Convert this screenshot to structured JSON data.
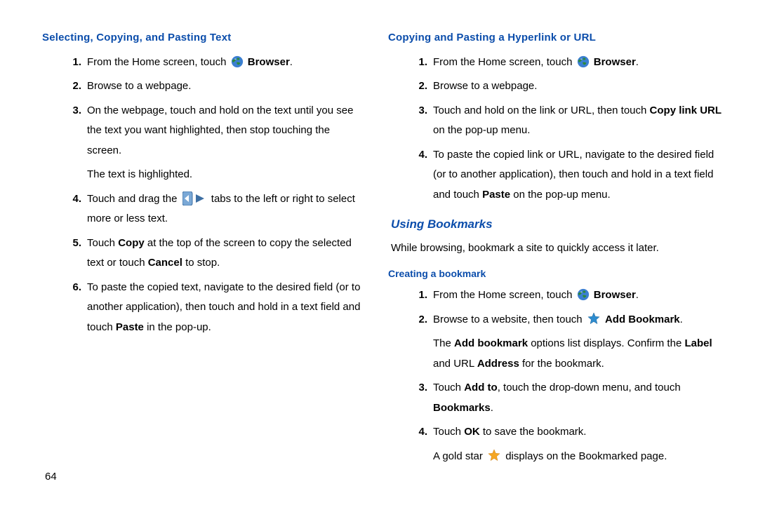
{
  "pagenum": "64",
  "left": {
    "h1": "Selecting, Copying, and Pasting Text",
    "s1a": "From the Home screen, touch ",
    "s1b_bold": "Browser",
    "s1c": ".",
    "s2": "Browse to a webpage.",
    "s3": "On the webpage, touch and hold on the text until you see the text you want highlighted, then stop touching the screen.",
    "s3_sub": "The text is highlighted.",
    "s4a": "Touch and drag the ",
    "s4b": " tabs to the left or right to select more or less text.",
    "s5a": "Touch ",
    "s5b_bold": "Copy",
    "s5c": " at the top of the screen to copy the selected text or touch ",
    "s5d_bold": "Cancel",
    "s5e": " to stop.",
    "s6a": "To paste the copied text, navigate to the desired field (or to another application), then touch and hold in a text field and touch ",
    "s6b_bold": "Paste",
    "s6c": " in the pop-up."
  },
  "rightA": {
    "h1": "Copying and Pasting a Hyperlink or URL",
    "s1a": "From the Home screen, touch ",
    "s1b_bold": "Browser",
    "s1c": ".",
    "s2": "Browse to a webpage.",
    "s3a": "Touch and hold on the link or URL, then touch ",
    "s3b_bold": "Copy link URL",
    "s3c": " on the pop-up menu.",
    "s4a": "To paste the copied link or URL, navigate to the desired field (or to another application), then touch and hold in a text field and touch ",
    "s4b_bold": "Paste",
    "s4c": " on the pop-up menu."
  },
  "rightB": {
    "h2": "Using Bookmarks",
    "intro": "While browsing, bookmark a site to quickly access it later.",
    "h3": "Creating a bookmark",
    "s1a": "From the Home screen, touch ",
    "s1b_bold": "Browser",
    "s1c": ".",
    "s2a": "Browse to a website, then touch ",
    "s2b_bold": "Add Bookmark",
    "s2c": ".",
    "s2_sub_a": "The ",
    "s2_sub_b_bold": "Add bookmark",
    "s2_sub_c": " options list displays. Confirm the ",
    "s2_sub_d_bold": "Label",
    "s2_sub_e": " and URL ",
    "s2_sub_f_bold": "Address",
    "s2_sub_g": " for the bookmark.",
    "s3a": "Touch ",
    "s3b_bold": "Add to",
    "s3c": ", touch the drop-down menu, and touch ",
    "s3d_bold": "Bookmarks",
    "s3e": ".",
    "s4a": "Touch ",
    "s4b_bold": "OK",
    "s4c": " to save the bookmark.",
    "s4_sub_a": "A gold star ",
    "s4_sub_b": " displays on the Bookmarked page."
  }
}
